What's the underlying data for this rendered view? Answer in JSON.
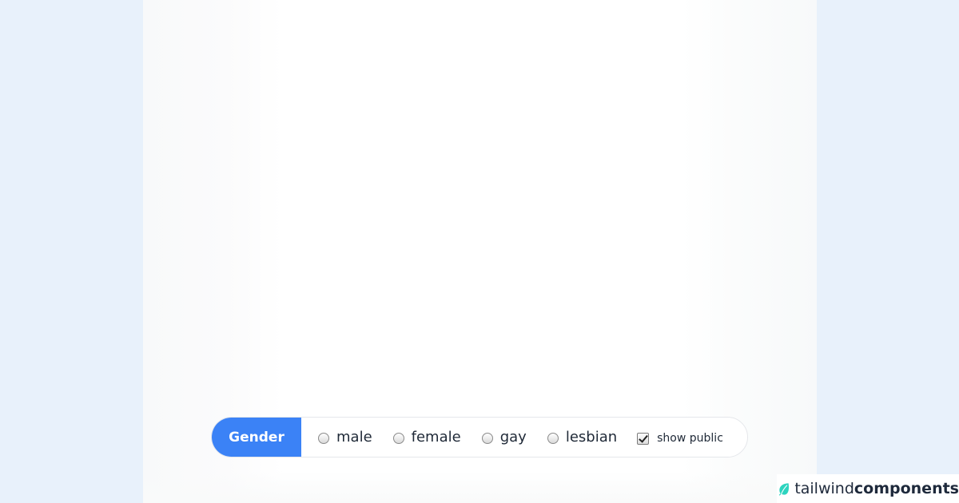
{
  "gender_form": {
    "label": "Gender",
    "options": [
      {
        "label": "male",
        "checked": false
      },
      {
        "label": "female",
        "checked": false
      },
      {
        "label": "gay",
        "checked": false
      },
      {
        "label": "lesbian",
        "checked": false
      }
    ],
    "show_public": {
      "label": "show public",
      "checked": true
    }
  },
  "branding": {
    "light": "tailwind",
    "bold": "components",
    "logo_icon": "leaf-icon",
    "logo_color": "#2dd4bf"
  },
  "colors": {
    "accent": "#3b82f6",
    "page_background": "#e8f1fb"
  }
}
